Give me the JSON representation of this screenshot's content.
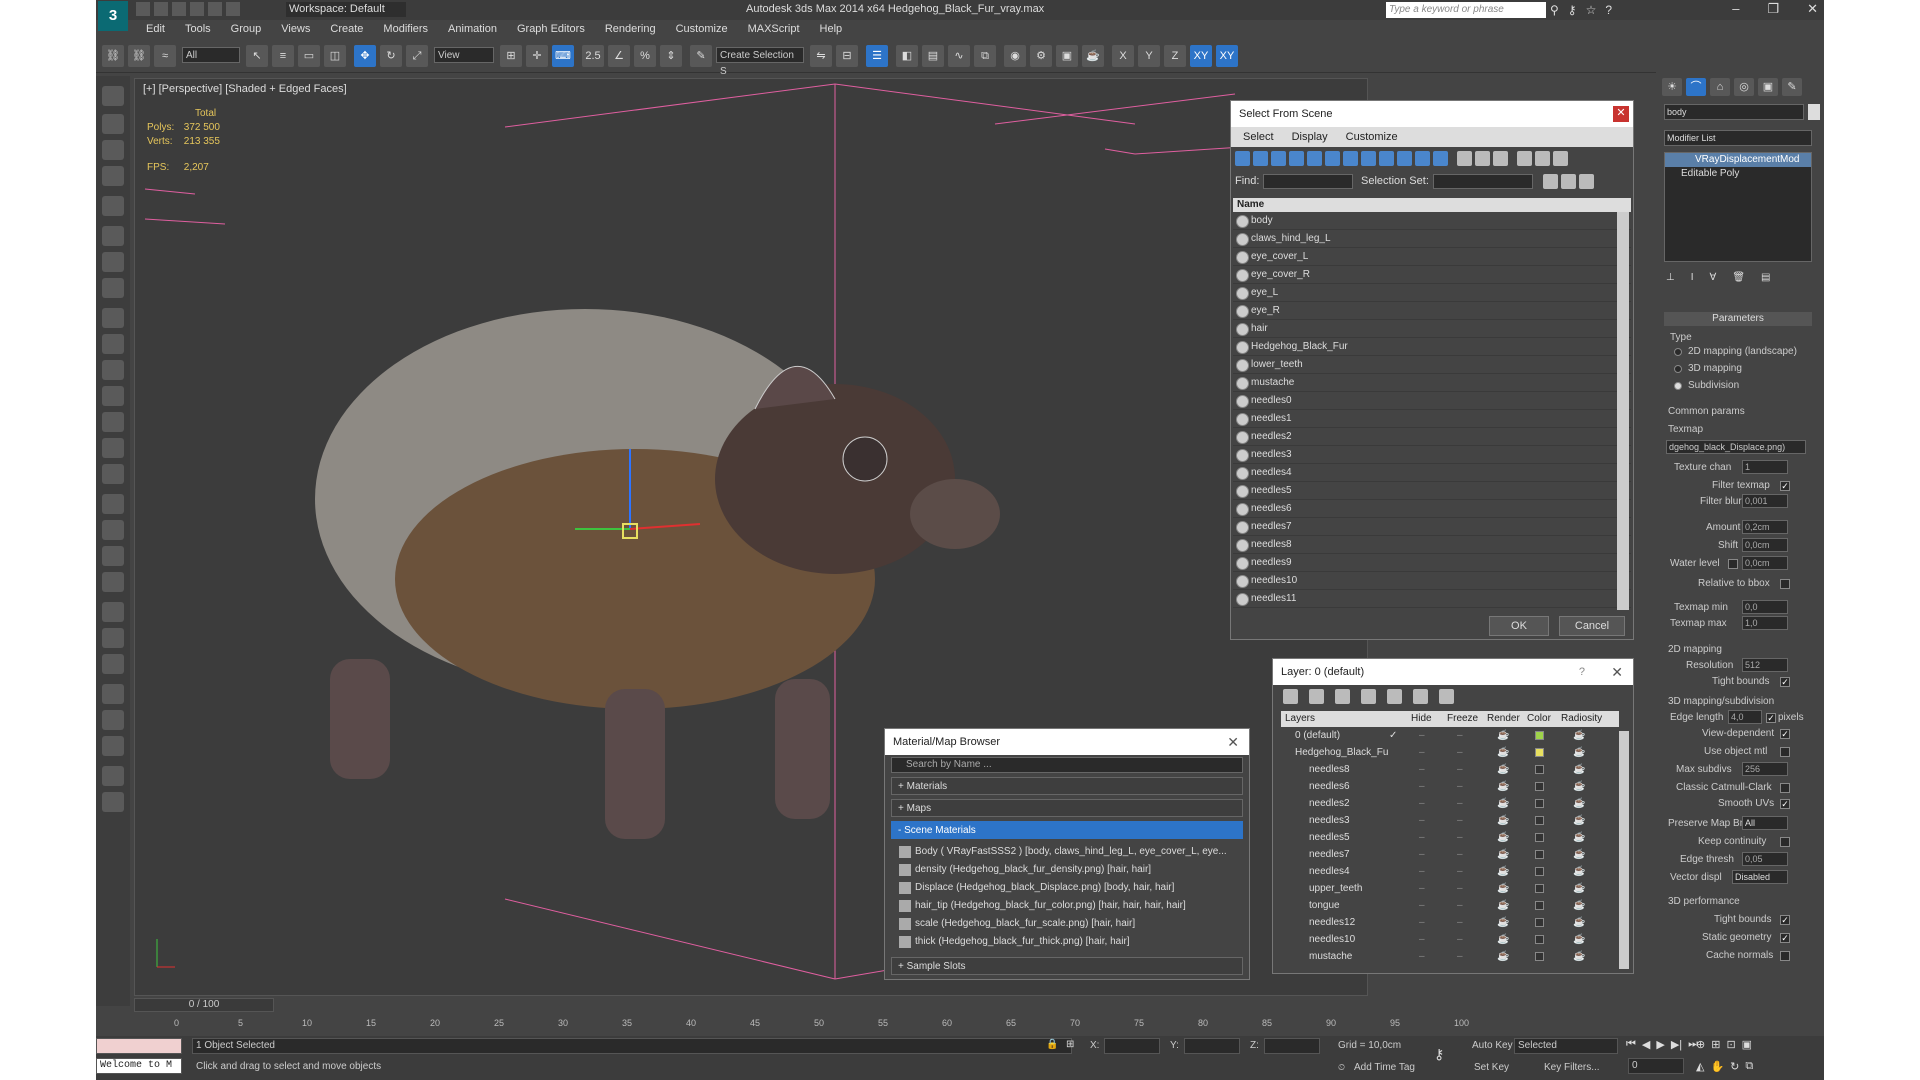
{
  "app": {
    "title": "Autodesk 3ds Max  2014 x64     Hedgehog_Black_Fur_vray.max",
    "workspace": "Workspace: Default",
    "search_placeholder": "Type a keyword or phrase",
    "logo": "3",
    "accent": "#2d74c8"
  },
  "menu": [
    "Edit",
    "Tools",
    "Group",
    "Views",
    "Create",
    "Modifiers",
    "Animation",
    "Graph Editors",
    "Rendering",
    "Customize",
    "MAXScript",
    "Help"
  ],
  "toolbar": {
    "filter": "All",
    "ref_coord": "View",
    "selection_set": "Create Selection S",
    "axes": [
      "X",
      "Y",
      "Z",
      "XY",
      "XY"
    ],
    "snap": "2.5",
    "angle": "%"
  },
  "viewport": {
    "label": "[+] [Perspective] [Shaded + Edged Faces]",
    "stats_title": "Total",
    "polys_label": "Polys:",
    "polys": "372 500",
    "verts_label": "Verts:",
    "verts": "213 355",
    "fps_label": "FPS:",
    "fps": "2,207"
  },
  "select_from_scene": {
    "title": "Select From Scene",
    "menu": [
      "Select",
      "Display",
      "Customize"
    ],
    "find_label": "Find:",
    "selection_set_label": "Selection Set:",
    "column": "Name",
    "items": [
      "body",
      "claws_hind_leg_L",
      "eye_cover_L",
      "eye_cover_R",
      "eye_L",
      "eye_R",
      "hair",
      "Hedgehog_Black_Fur",
      "lower_teeth",
      "mustache",
      "needles0",
      "needles1",
      "needles2",
      "needles3",
      "needles4",
      "needles5",
      "needles6",
      "needles7",
      "needles8",
      "needles9",
      "needles10",
      "needles11"
    ],
    "ok": "OK",
    "cancel": "Cancel"
  },
  "layer_dialog": {
    "title": "Layer: 0 (default)",
    "help": "?",
    "columns": [
      "Layers",
      "Hide",
      "Freeze",
      "Render",
      "Color",
      "Radiosity"
    ],
    "rows": [
      {
        "name": "0 (default)",
        "check": "✓",
        "color": "#9fd34a"
      },
      {
        "name": "Hedgehog_Black_Fu",
        "check": "",
        "color": "#e8e060"
      },
      {
        "name": "needles8",
        "color": "#333"
      },
      {
        "name": "needles6",
        "color": "#333"
      },
      {
        "name": "needles2",
        "color": "#333"
      },
      {
        "name": "needles3",
        "color": "#333"
      },
      {
        "name": "needles5",
        "color": "#333"
      },
      {
        "name": "needles7",
        "color": "#333"
      },
      {
        "name": "needles4",
        "color": "#333"
      },
      {
        "name": "upper_teeth",
        "color": "#333"
      },
      {
        "name": "tongue",
        "color": "#333"
      },
      {
        "name": "needles12",
        "color": "#333"
      },
      {
        "name": "needles10",
        "color": "#333"
      },
      {
        "name": "mustache",
        "color": "#333"
      }
    ]
  },
  "material_browser": {
    "title": "Material/Map Browser",
    "search_placeholder": "Search by Name ...",
    "rollouts": {
      "materials": "+ Materials",
      "maps": "+ Maps",
      "scene_materials": "- Scene Materials",
      "sample_slots": "+ Sample Slots"
    },
    "items": [
      "Body  ( VRayFastSSS2 )  [body, claws_hind_leg_L, eye_cover_L, eye...",
      "density (Hedgehog_black_fur_density.png) [hair, hair]",
      "Displace (Hedgehog_black_Displace.png) [body, hair, hair]",
      "hair_tip (Hedgehog_black_fur_color.png) [hair, hair, hair, hair]",
      "scale (Hedgehog_black_fur_scale.png) [hair, hair]",
      "thick (Hedgehog_black_fur_thick.png) [hair, hair]"
    ]
  },
  "command_panel": {
    "object_name": "body",
    "modifier_list": "Modifier List",
    "stack": [
      "VRayDisplacementMod",
      "Editable Poly"
    ],
    "parameters": "Parameters",
    "type_label": "Type",
    "types": [
      "2D mapping (landscape)",
      "3D mapping",
      "Subdivision"
    ],
    "common_params": "Common params",
    "texmap_label": "Texmap",
    "texmap": "dgehog_black_Displace.png)",
    "texture_chan_label": "Texture chan",
    "texture_chan": "1",
    "filter_texmap": "Filter texmap",
    "filter_blur_label": "Filter blur",
    "filter_blur": "0,001",
    "amount_label": "Amount",
    "amount": "0,2cm",
    "shift_label": "Shift",
    "shift": "0,0cm",
    "water_level_label": "Water level",
    "water_level": "0,0cm",
    "relative_bbox": "Relative to bbox",
    "texmap_min_label": "Texmap min",
    "texmap_min": "0,0",
    "texmap_max_label": "Texmap max",
    "texmap_max": "1,0",
    "mapping2d": "2D mapping",
    "resolution_label": "Resolution",
    "resolution": "512",
    "tight_bounds": "Tight bounds",
    "mapping3d": "3D mapping/subdivision",
    "edge_length_label": "Edge length",
    "edge_length": "4,0",
    "pixels": "pixels",
    "view_dependent": "View-dependent",
    "use_object_mtl": "Use object mtl",
    "max_subdivs_label": "Max subdivs",
    "max_subdivs": "256",
    "classic_catmull": "Classic Catmull-Clark",
    "smooth_uvs": "Smooth UVs",
    "preserve_map_bnd_label": "Preserve Map Bnd",
    "preserve_map_bnd": "All",
    "keep_continuity": "Keep continuity",
    "edge_thresh_label": "Edge thresh",
    "edge_thresh": "0,05",
    "vector_displ_label": "Vector displ",
    "vector_displ": "Disabled",
    "performance": "3D performance",
    "tight_bounds2": "Tight bounds",
    "static_geometry": "Static geometry",
    "cache_normals": "Cache normals"
  },
  "timeline": {
    "frame": "0 / 100",
    "ticks": [
      "0",
      "5",
      "10",
      "15",
      "20",
      "25",
      "30",
      "35",
      "40",
      "45",
      "50",
      "55",
      "60",
      "65",
      "70",
      "75",
      "80",
      "85",
      "90",
      "95",
      "100"
    ]
  },
  "status": {
    "maxscript": "Welcome to M",
    "selected": "1 Object Selected",
    "prompt": "Click and drag to select and move objects",
    "x_label": "X:",
    "y_label": "Y:",
    "z_label": "Z:",
    "grid": "Grid = 10,0cm",
    "auto_key": "Auto Key",
    "set_key": "Set Key",
    "selected_dd": "Selected",
    "key_filters": "Key Filters...",
    "add_time_tag": "Add Time Tag",
    "frame_field": "0"
  }
}
